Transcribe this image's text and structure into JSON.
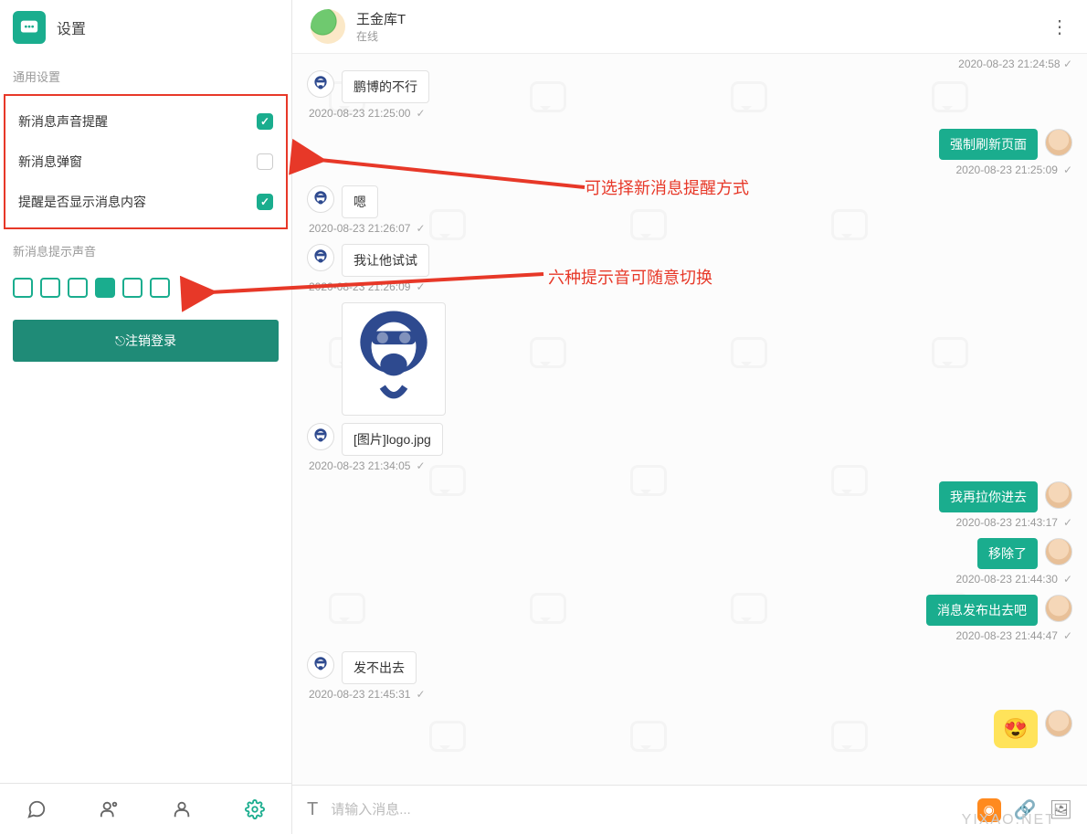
{
  "colors": {
    "accent": "#1aad8e",
    "danger": "#e73828"
  },
  "left": {
    "title": "设置",
    "section1": "通用设置",
    "settings": [
      {
        "label": "新消息声音提醒",
        "checked": true
      },
      {
        "label": "新消息弹窗",
        "checked": false
      },
      {
        "label": "提醒是否显示消息内容",
        "checked": true
      }
    ],
    "section2": "新消息提示声音",
    "sound_selected_index": 3,
    "sound_count": 6,
    "logout": "注销登录"
  },
  "header": {
    "name": "王金库T",
    "status": "在线"
  },
  "top_timestamp": "2020-08-23 21:24:58",
  "messages": [
    {
      "side": "left",
      "avatar": "monkey",
      "text": "鹏博的不行",
      "ts": "2020-08-23 21:25:00"
    },
    {
      "side": "right",
      "avatar": "man",
      "text": "强制刷新页面",
      "ts": "2020-08-23 21:25:09"
    },
    {
      "side": "left",
      "avatar": "monkey",
      "text": "嗯",
      "ts": "2020-08-23 21:26:07"
    },
    {
      "side": "left",
      "avatar": "monkey",
      "text": "我让他试试",
      "ts": "2020-08-23 21:26:09"
    },
    {
      "side": "left",
      "avatar": "monkey",
      "type": "image",
      "ts": ""
    },
    {
      "side": "left",
      "avatar": "monkey",
      "text": "[图片]logo.jpg",
      "ts": "2020-08-23 21:34:05"
    },
    {
      "side": "right",
      "avatar": "man",
      "text": "我再拉你进去",
      "ts": "2020-08-23 21:43:17"
    },
    {
      "side": "right",
      "avatar": "man",
      "text": "移除了",
      "ts": "2020-08-23 21:44:30"
    },
    {
      "side": "right",
      "avatar": "man",
      "text": "消息发布出去吧",
      "ts": "2020-08-23 21:44:47"
    },
    {
      "side": "left",
      "avatar": "monkey",
      "text": "发不出去",
      "ts": "2020-08-23 21:45:31"
    },
    {
      "side": "right",
      "avatar": "man",
      "type": "sticker"
    }
  ],
  "input": {
    "placeholder": "请输入消息..."
  },
  "annotations": {
    "a1": "可选择新消息提醒方式",
    "a2": "六种提示音可随意切换"
  },
  "watermark": "YIXAO.NET"
}
